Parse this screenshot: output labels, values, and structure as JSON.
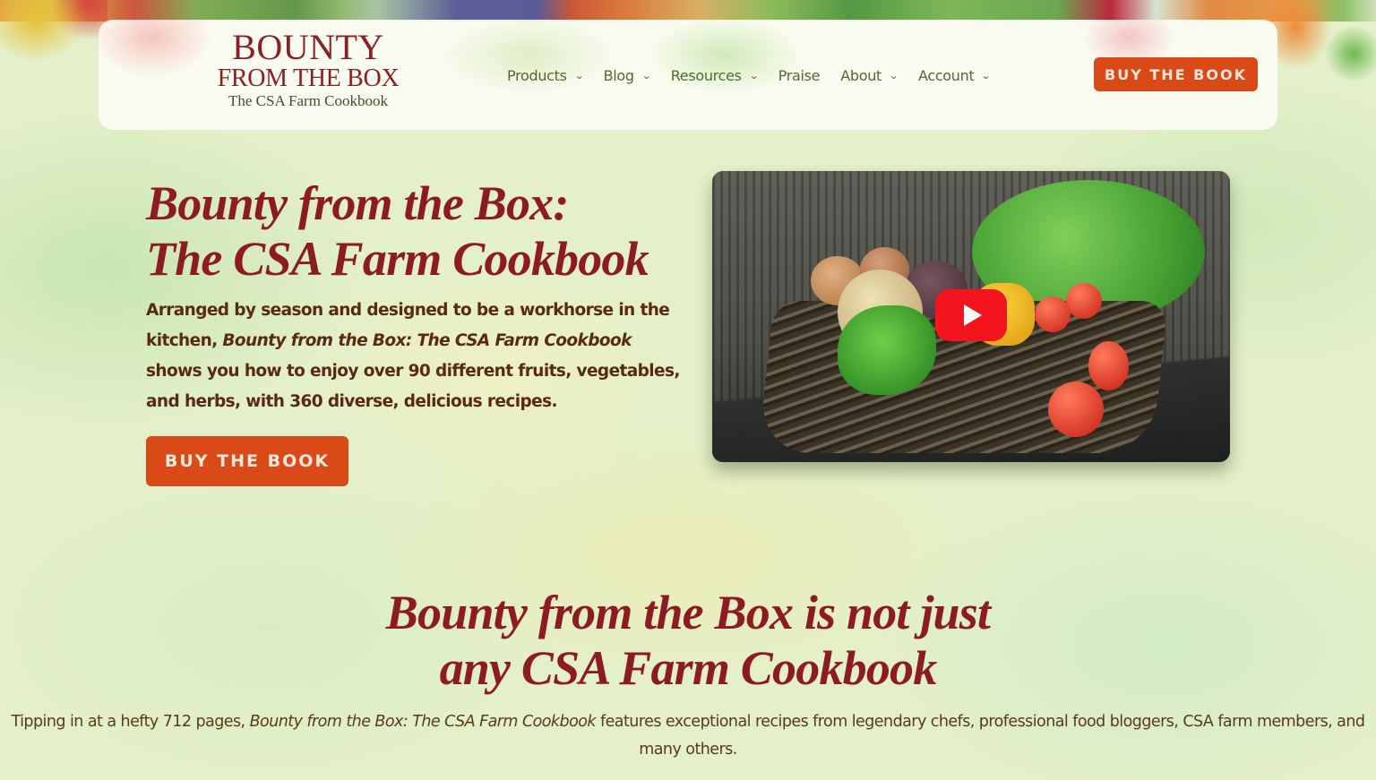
{
  "header": {
    "logo": {
      "line1": "BOUNTY",
      "line2": "FROM THE BOX",
      "line3": "The CSA Farm Cookbook"
    },
    "nav": [
      {
        "label": "Products",
        "has_dropdown": true,
        "icon": "chevron-down-icon"
      },
      {
        "label": "Blog",
        "has_dropdown": true,
        "icon": "chevron-down-icon"
      },
      {
        "label": "Resources",
        "has_dropdown": true,
        "icon": "chevron-down-icon"
      },
      {
        "label": "Praise",
        "has_dropdown": false
      },
      {
        "label": "About",
        "has_dropdown": true,
        "icon": "chevron-down-icon"
      },
      {
        "label": "Account",
        "has_dropdown": true,
        "icon": "chevron-down-icon"
      }
    ],
    "chevron_glyph": "⌄",
    "cta_label": "BUY THE BOOK"
  },
  "hero": {
    "title_line1": "Bounty from the Box:",
    "title_line2": "The CSA Farm Cookbook",
    "text_part1": "Arranged by season and designed to be a workhorse in the kitchen, ",
    "text_italic": "Bounty from the Box: The CSA Farm Cookbook",
    "text_part2": " shows you how to enjoy over 90 different fruits, vegetables, and herbs, with 360 diverse, delicious recipes.",
    "cta_label": "BUY THE BOOK",
    "video": {
      "description": "Basket of vegetables",
      "play_icon": "youtube-play-icon"
    }
  },
  "section": {
    "title_line1": "Bounty from the Box is not just",
    "title_line2": "any CSA Farm Cookbook",
    "text_part1": "Tipping in at a hefty 712 pages, ",
    "text_italic": "Bounty from the Box: The CSA Farm Cookbook",
    "text_part2": " features exceptional recipes from legendary chefs, professional food bloggers, CSA farm members, and many others."
  },
  "colors": {
    "brand_red": "#8d1b23",
    "cta_orange": "#d94a18",
    "nav_green": "#4e6a2f",
    "body_brown": "#5a2a10",
    "youtube_red": "#f3141d"
  }
}
